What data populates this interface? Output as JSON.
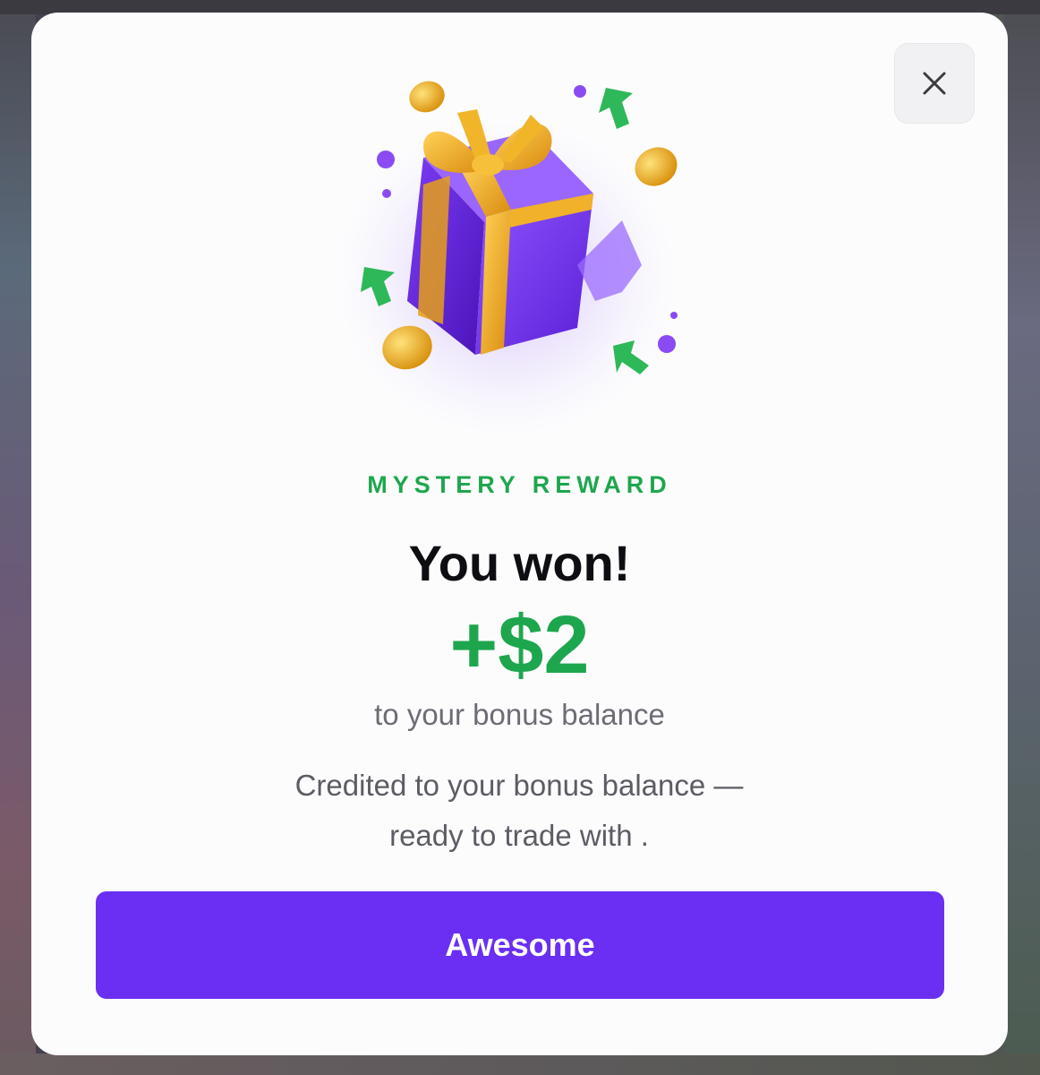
{
  "modal": {
    "close_icon": "close-icon",
    "hero_icon": "gift-box-icon",
    "eyebrow": "MYSTERY REWARD",
    "title": "You won!",
    "amount": "+$2",
    "subtitle": "to your bonus balance",
    "description_line1": "Credited to your bonus balance —",
    "description_line2": "ready to trade with .",
    "cta_label": "Awesome"
  },
  "colors": {
    "accent_green": "#1ea64e",
    "button_purple": "#6a2ff2",
    "gift_purple": "#7a3cf0",
    "ribbon_gold": "#e9a81c"
  }
}
